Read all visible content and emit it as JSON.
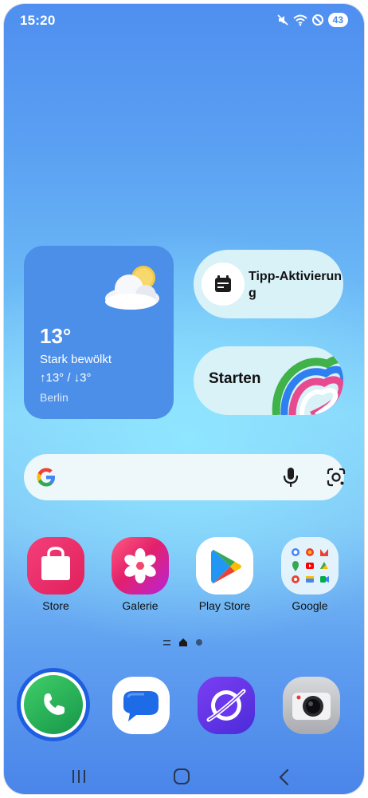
{
  "status_bar": {
    "time": "15:20",
    "battery": "43",
    "icons": [
      "mute-icon",
      "wifi-icon",
      "do-not-disturb-icon",
      "battery-icon"
    ]
  },
  "weather_widget": {
    "temperature": "13°",
    "condition": "Stark bewölkt",
    "range": "↑13° / ↓3°",
    "city": "Berlin",
    "icon": "partly-cloudy-icon"
  },
  "tip_widget": {
    "label": "Tipp-Aktivierung",
    "icon": "calendar-icon"
  },
  "start_widget": {
    "label": "Starten",
    "icon": "heart-rainbow-icon"
  },
  "search_bar": {
    "icons": [
      "google-g-icon",
      "microphone-icon",
      "google-lens-icon"
    ]
  },
  "apps": [
    {
      "label": "Store",
      "icon": "galaxy-store-icon"
    },
    {
      "label": "Galerie",
      "icon": "gallery-flower-icon"
    },
    {
      "label": "Play Store",
      "icon": "play-store-icon"
    },
    {
      "label": "Google",
      "icon": "google-folder-icon"
    }
  ],
  "dock": [
    {
      "name": "Phone",
      "icon": "phone-icon"
    },
    {
      "name": "Messages",
      "icon": "messages-icon"
    },
    {
      "name": "Internet",
      "icon": "internet-icon"
    },
    {
      "name": "Camera",
      "icon": "camera-icon"
    }
  ],
  "page_indicator": {
    "pages": 2,
    "current": 1
  },
  "nav_bar": {
    "buttons": [
      "recent-apps-button",
      "home-button",
      "back-button"
    ]
  },
  "colors": {
    "weather_bg": "#4c8fe8",
    "pill_bg": "#d8f2f8",
    "phone_green": "#1e9e4a",
    "phone_ring": "#1d5fe0"
  }
}
